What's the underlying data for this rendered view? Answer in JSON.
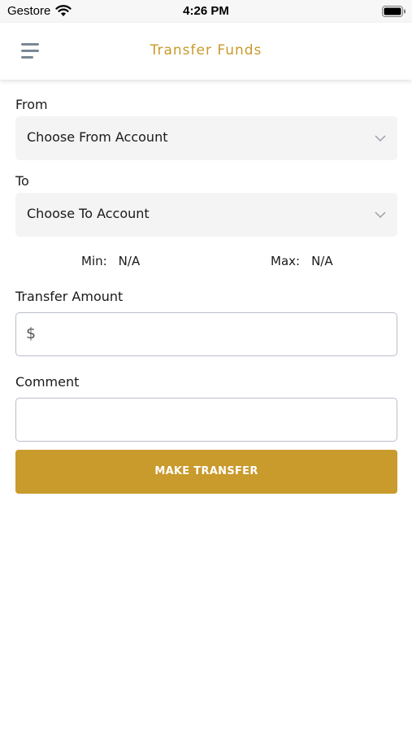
{
  "status_bar": {
    "carrier": "Gestore",
    "time": "4:26 PM"
  },
  "header": {
    "title": "Transfer Funds"
  },
  "form": {
    "from_label": "From",
    "from_value": "Choose From Account",
    "to_label": "To",
    "to_value": "Choose To Account",
    "min_label": "Min:",
    "min_value": "N/A",
    "max_label": "Max:",
    "max_value": "N/A",
    "amount_label": "Transfer Amount",
    "amount_prefix": "$",
    "amount_value": "",
    "comment_label": "Comment",
    "comment_value": "",
    "submit_label": "MAKE TRANSFER"
  },
  "colors": {
    "accent": "#c99a2c",
    "field_background": "#f4f4f4",
    "field_border": "#b9bec7",
    "menu_icon": "#7b8794"
  }
}
